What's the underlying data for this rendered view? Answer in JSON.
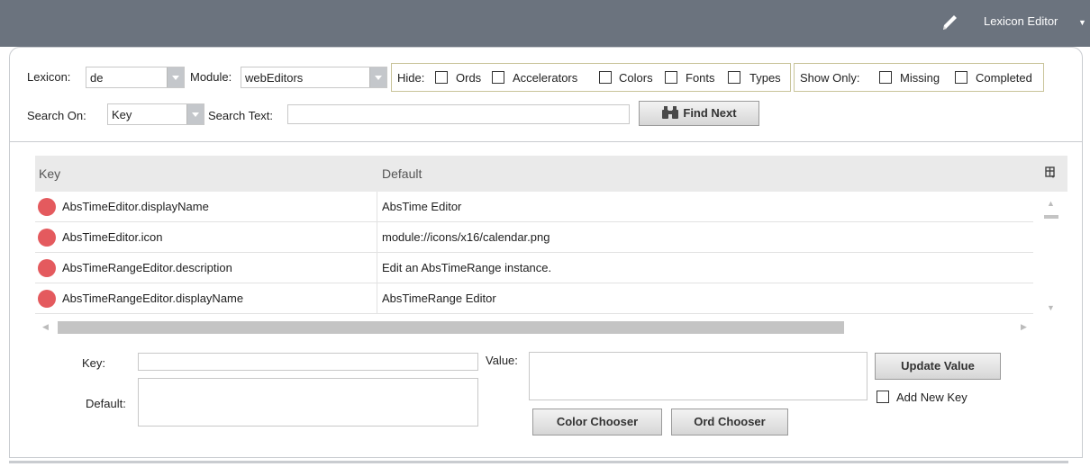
{
  "header": {
    "view_label": "Lexicon Editor"
  },
  "toolbar": {
    "lexicon_label": "Lexicon:",
    "lexicon_value": "de",
    "module_label": "Module:",
    "module_value": "webEditors",
    "hide_label": "Hide:",
    "hide_options": [
      "Ords",
      "Accelerators",
      "Colors",
      "Fonts",
      "Types"
    ],
    "show_only_label": "Show Only:",
    "show_only_options": [
      "Missing",
      "Completed"
    ],
    "search_on_label": "Search On:",
    "search_on_value": "Key",
    "search_text_label": "Search Text:",
    "search_text_value": "",
    "find_next_label": "Find Next"
  },
  "table": {
    "columns": [
      "Key",
      "Default"
    ],
    "rows": [
      {
        "key": "AbsTimeEditor.displayName",
        "default": "AbsTime Editor",
        "status_color": "#e45a5e"
      },
      {
        "key": "AbsTimeEditor.icon",
        "default": "module://icons/x16/calendar.png",
        "status_color": "#e45a5e"
      },
      {
        "key": "AbsTimeRangeEditor.description",
        "default": "Edit an AbsTimeRange instance.",
        "status_color": "#e45a5e"
      },
      {
        "key": "AbsTimeRangeEditor.displayName",
        "default": "AbsTimeRange Editor",
        "status_color": "#e45a5e"
      }
    ]
  },
  "editor": {
    "key_label": "Key:",
    "key_value": "",
    "default_label": "Default:",
    "default_value": "",
    "value_label": "Value:",
    "value_value": "",
    "update_value_label": "Update Value",
    "add_new_key_label": "Add New Key",
    "color_chooser_label": "Color Chooser",
    "ord_chooser_label": "Ord Chooser"
  },
  "colors": {
    "topbar": "#6b737e",
    "status_missing": "#e45a5e"
  }
}
